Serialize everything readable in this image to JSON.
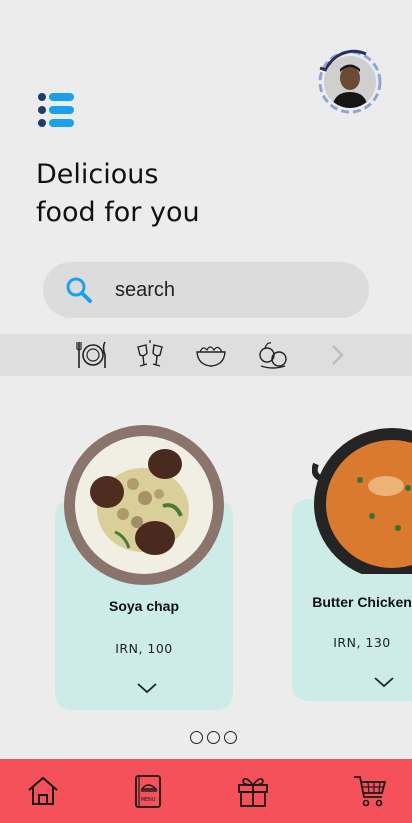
{
  "header": {
    "title_line1": "Delicious",
    "title_line2": "food for you"
  },
  "icons": {
    "menu": "list-menu-icon",
    "search": "search-icon",
    "avatar": "user-avatar"
  },
  "search": {
    "placeholder": "search",
    "value": ""
  },
  "categories": [
    {
      "icon": "plate-cutlery-icon"
    },
    {
      "icon": "cheers-glasses-icon"
    },
    {
      "icon": "salad-bowl-icon"
    },
    {
      "icon": "fruits-vegetables-icon"
    },
    {
      "icon": "chevron-right-icon"
    }
  ],
  "cards": [
    {
      "name": "Soya chap",
      "price": "IRN, 100"
    },
    {
      "name": "Butter Chicken",
      "price": "IRN, 130"
    }
  ],
  "pagination": {
    "total": 3
  },
  "bottom_nav": [
    {
      "icon": "home-icon"
    },
    {
      "icon": "menu-book-icon",
      "label": "MENU"
    },
    {
      "icon": "gift-icon"
    },
    {
      "icon": "shopping-cart-icon"
    }
  ],
  "colors": {
    "background": "#ececec",
    "accent_blue": "#1aa0ec",
    "menu_dark": "#1d3d6b",
    "card": "#cdebe9",
    "bottom_nav": "#f4515a"
  }
}
